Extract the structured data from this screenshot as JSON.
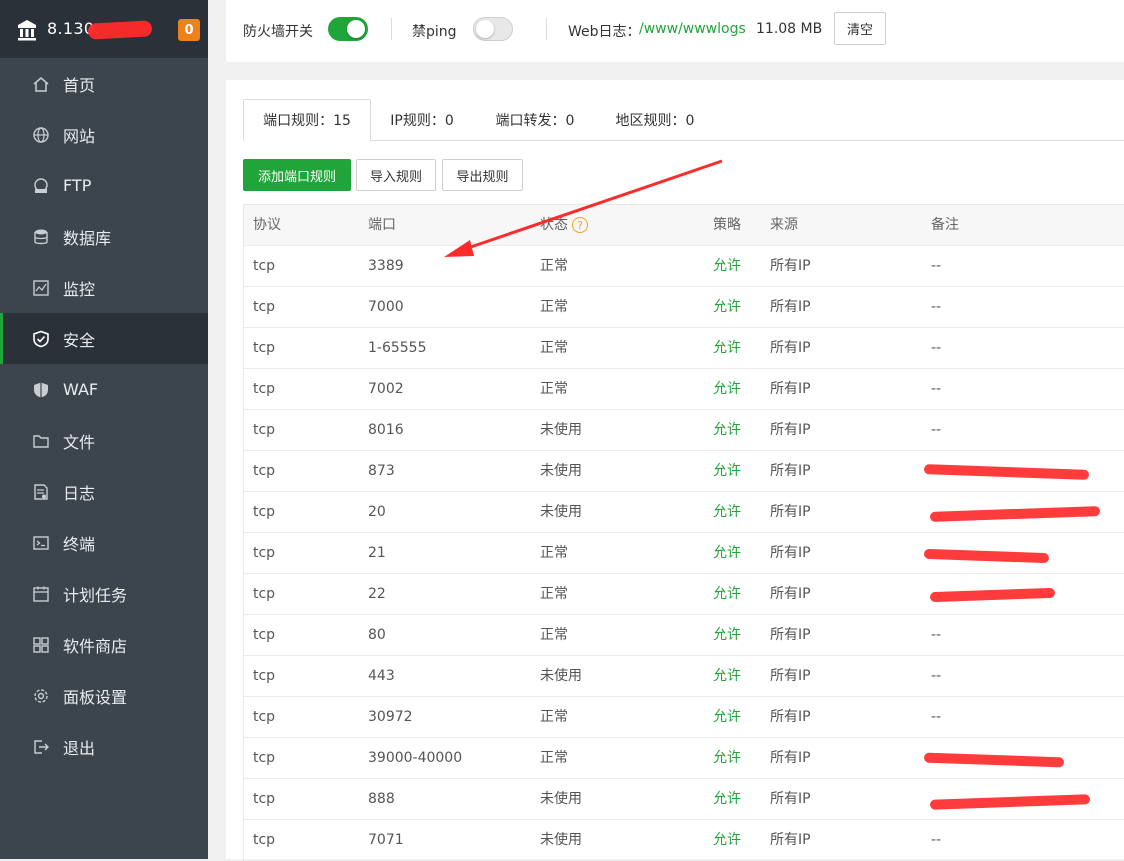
{
  "sidebar": {
    "server_ip": "8.130.",
    "badge_count": "0",
    "items": [
      {
        "label": "首页",
        "icon": "home-icon"
      },
      {
        "label": "网站",
        "icon": "globe-icon"
      },
      {
        "label": "FTP",
        "icon": "ftp-icon"
      },
      {
        "label": "数据库",
        "icon": "database-icon"
      },
      {
        "label": "监控",
        "icon": "monitor-icon"
      },
      {
        "label": "安全",
        "icon": "shield-check-icon",
        "active": true
      },
      {
        "label": "WAF",
        "icon": "waf-shield-icon"
      },
      {
        "label": "文件",
        "icon": "folder-icon"
      },
      {
        "label": "日志",
        "icon": "log-file-icon"
      },
      {
        "label": "终端",
        "icon": "terminal-icon"
      },
      {
        "label": "计划任务",
        "icon": "calendar-icon"
      },
      {
        "label": "软件商店",
        "icon": "grid-apps-icon"
      },
      {
        "label": "面板设置",
        "icon": "gear-icon"
      },
      {
        "label": "退出",
        "icon": "logout-icon"
      }
    ]
  },
  "topbar": {
    "firewall_label": "防火墙开关",
    "firewall_on": true,
    "ping_label": "禁ping",
    "ping_on": false,
    "weblog_label": "Web日志：",
    "weblog_path": "/www/wwwlogs",
    "weblog_size": "11.08 MB",
    "clear_label": "清空"
  },
  "tabs": [
    {
      "label": "端口规则：15",
      "active": true
    },
    {
      "label": "IP规则：0"
    },
    {
      "label": "端口转发：0"
    },
    {
      "label": "地区规则：0"
    }
  ],
  "actions": {
    "add_label": "添加端口规则",
    "import_label": "导入规则",
    "export_label": "导出规则"
  },
  "table": {
    "headers": [
      "协议",
      "端口",
      "状态",
      "策略",
      "来源",
      "备注"
    ],
    "rows": [
      {
        "proto": "tcp",
        "port": "3389",
        "status": "正常",
        "policy": "允许",
        "source": "所有IP",
        "note": "--"
      },
      {
        "proto": "tcp",
        "port": "7000",
        "status": "正常",
        "policy": "允许",
        "source": "所有IP",
        "note": "--"
      },
      {
        "proto": "tcp",
        "port": "1-65555",
        "status": "正常",
        "policy": "允许",
        "source": "所有IP",
        "note": "--"
      },
      {
        "proto": "tcp",
        "port": "7002",
        "status": "正常",
        "policy": "允许",
        "source": "所有IP",
        "note": "--"
      },
      {
        "proto": "tcp",
        "port": "8016",
        "status": "未使用",
        "policy": "允许",
        "source": "所有IP",
        "note": "--"
      },
      {
        "proto": "tcp",
        "port": "873",
        "status": "未使用",
        "policy": "允许",
        "source": "所有IP",
        "note": "",
        "redacted": true
      },
      {
        "proto": "tcp",
        "port": "20",
        "status": "未使用",
        "policy": "允许",
        "source": "所有IP",
        "note": "",
        "redacted": true
      },
      {
        "proto": "tcp",
        "port": "21",
        "status": "正常",
        "policy": "允许",
        "source": "所有IP",
        "note": "",
        "redacted": true
      },
      {
        "proto": "tcp",
        "port": "22",
        "status": "正常",
        "policy": "允许",
        "source": "所有IP",
        "note": "",
        "redacted": true
      },
      {
        "proto": "tcp",
        "port": "80",
        "status": "正常",
        "policy": "允许",
        "source": "所有IP",
        "note": "--"
      },
      {
        "proto": "tcp",
        "port": "443",
        "status": "未使用",
        "policy": "允许",
        "source": "所有IP",
        "note": "--"
      },
      {
        "proto": "tcp",
        "port": "30972",
        "status": "正常",
        "policy": "允许",
        "source": "所有IP",
        "note": "--"
      },
      {
        "proto": "tcp",
        "port": "39000-40000",
        "status": "正常",
        "policy": "允许",
        "source": "所有IP",
        "note": "",
        "redacted": true
      },
      {
        "proto": "tcp",
        "port": "888",
        "status": "未使用",
        "policy": "允许",
        "source": "所有IP",
        "note": "",
        "redacted": true
      },
      {
        "proto": "tcp",
        "port": "7071",
        "status": "未使用",
        "policy": "允许",
        "source": "所有IP",
        "note": "--"
      }
    ]
  },
  "colors": {
    "accent_green": "#20a53a",
    "sidebar_bg": "#3c444d",
    "annotation_red": "#ff2a2a",
    "badge_orange": "#f0801a"
  }
}
